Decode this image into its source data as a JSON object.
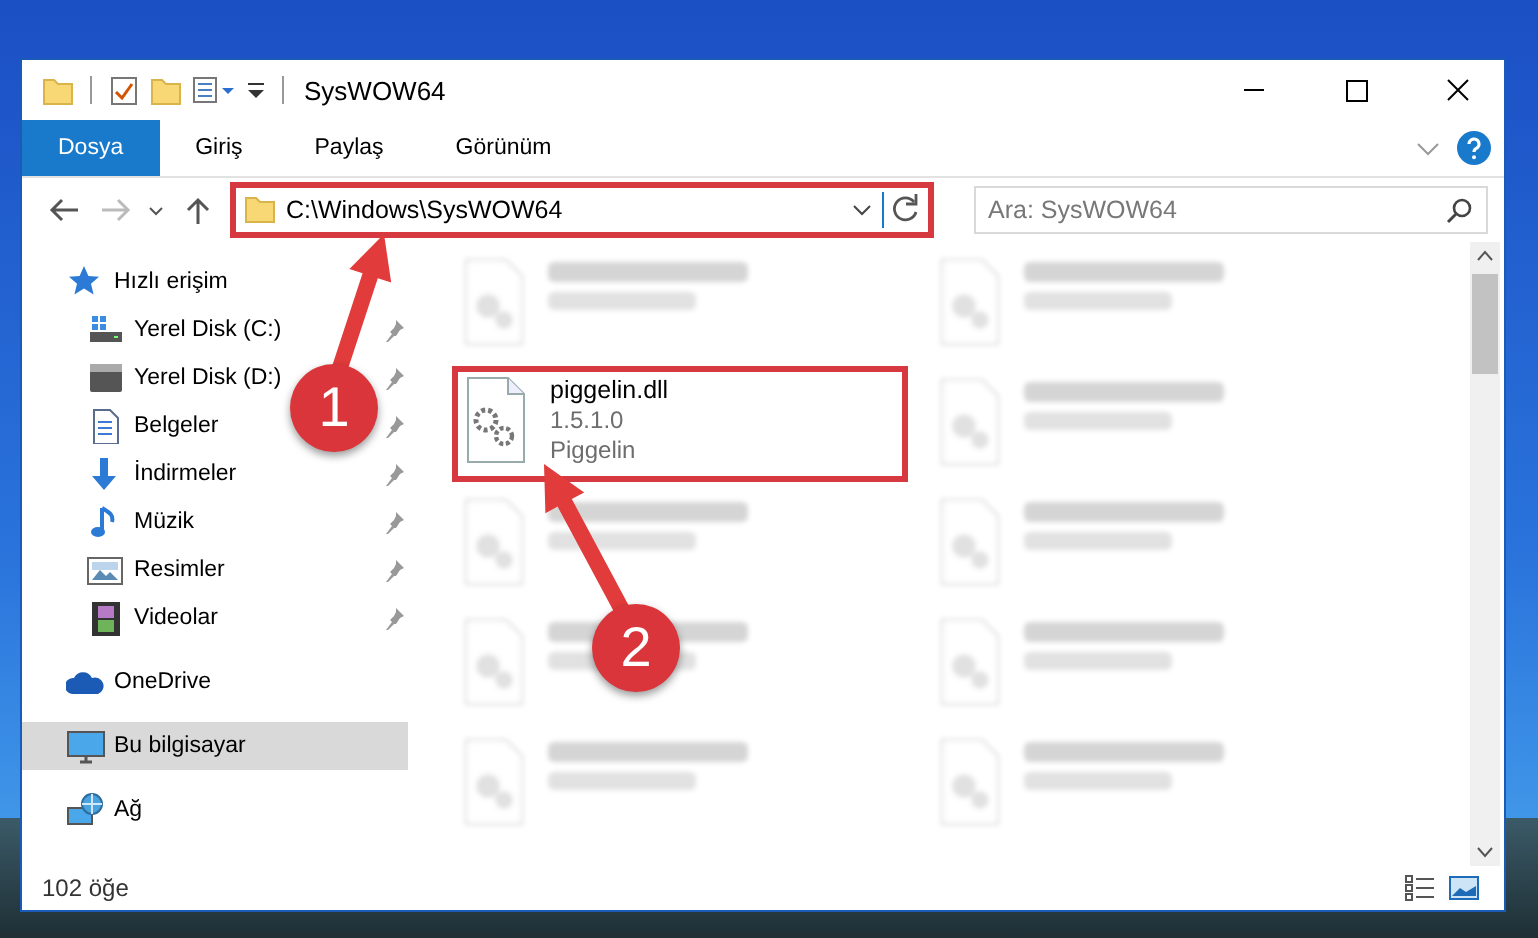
{
  "window": {
    "title": "SysWOW64"
  },
  "ribbon_tabs": [
    {
      "label": "Dosya",
      "selected": true
    },
    {
      "label": "Giriş",
      "selected": false
    },
    {
      "label": "Paylaş",
      "selected": false
    },
    {
      "label": "Görünüm",
      "selected": false
    }
  ],
  "address": {
    "value": "C:\\Windows\\SysWOW64",
    "highlighted": true
  },
  "search": {
    "placeholder": "Ara: SysWOW64"
  },
  "sidebar": {
    "items": [
      {
        "label": "Hızlı erişim",
        "kind": "star",
        "selected": false,
        "children": [
          {
            "label": "Yerel Disk (C:)",
            "kind": "system-drive",
            "pinned": true,
            "selected": false
          },
          {
            "label": "Yerel Disk (D:)",
            "kind": "drive",
            "pinned": true,
            "selected": false
          },
          {
            "label": "Belgeler",
            "kind": "document",
            "pinned": true,
            "selected": false
          },
          {
            "label": "İndirmeler",
            "kind": "download",
            "pinned": true,
            "selected": false
          },
          {
            "label": "Müzik",
            "kind": "music",
            "pinned": true,
            "selected": false
          },
          {
            "label": "Resimler",
            "kind": "pictures",
            "pinned": true,
            "selected": false
          },
          {
            "label": "Videolar",
            "kind": "video",
            "pinned": true,
            "selected": false
          }
        ]
      },
      {
        "label": "OneDrive",
        "kind": "cloud",
        "selected": false
      },
      {
        "label": "Bu bilgisayar",
        "kind": "computer",
        "selected": true
      },
      {
        "label": "Ağ",
        "kind": "network",
        "selected": false
      }
    ]
  },
  "files": [
    {
      "kind": "blurred"
    },
    {
      "kind": "blurred"
    },
    {
      "kind": "file",
      "name": "piggelin.dll",
      "detail_1": "1.5.1.0",
      "detail_2": "Piggelin",
      "highlighted": true
    },
    {
      "kind": "blurred"
    },
    {
      "kind": "blurred"
    },
    {
      "kind": "blurred"
    },
    {
      "kind": "blurred"
    },
    {
      "kind": "blurred"
    },
    {
      "kind": "blurred"
    },
    {
      "kind": "blurred"
    }
  ],
  "status_bar": {
    "count": "102 öğe"
  },
  "annotations": [
    {
      "label": "1"
    },
    {
      "label": "2"
    }
  ]
}
